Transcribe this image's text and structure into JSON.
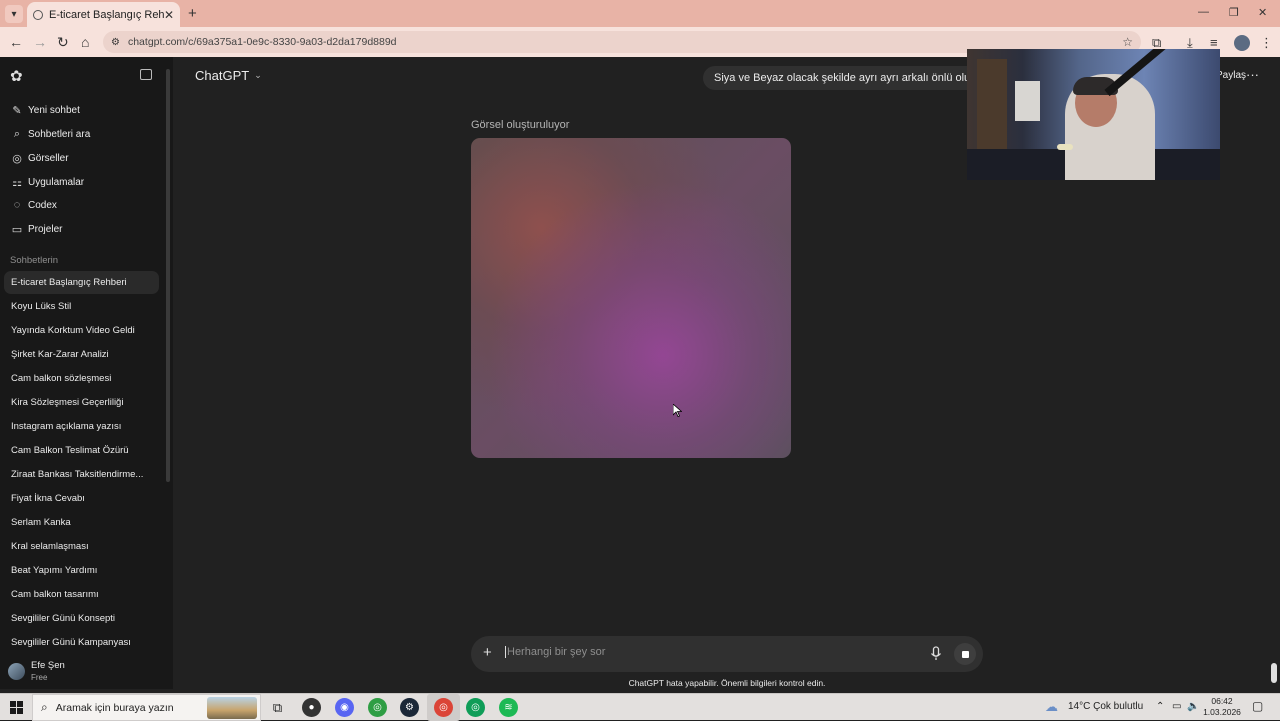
{
  "browser": {
    "tab_title": "E-ticaret Başlangıç Rehberi",
    "url": "chatgpt.com/c/69a375a1-0e9c-8330-9a03-d2da179d889d"
  },
  "sidebar": {
    "nav": [
      {
        "label": "Yeni sohbet",
        "icon": "edit-icon"
      },
      {
        "label": "Sohbetleri ara",
        "icon": "search-icon"
      },
      {
        "label": "Görseller",
        "icon": "images-icon"
      },
      {
        "label": "Uygulamalar",
        "icon": "apps-icon"
      },
      {
        "label": "Codex",
        "icon": "codex-icon"
      },
      {
        "label": "Projeler",
        "icon": "folder-icon"
      }
    ],
    "section_label": "Sohbetlerin",
    "chats": [
      "E-ticaret Başlangıç Rehberi",
      "Koyu Lüks Stil",
      "Yayında Korktum Video Geldi",
      "Şirket Kar-Zarar Analizi",
      "Cam balkon sözleşmesi",
      "Kira Sözleşmesi Geçerliliği",
      "Instagram açıklama yazısı",
      "Cam Balkon Teslimat Özürü",
      "Ziraat Bankası Taksitlendirme...",
      "Fiyat İkna Cevabı",
      "Serlam Kanka",
      "Kral selamlaşması",
      "Beat Yapımı Yardımı",
      "Cam balkon tasarımı",
      "Sevgililer Günü Konsepti",
      "Sevgililer Günü Kampanyası"
    ],
    "user": {
      "name": "Efe Şen",
      "plan": "Free"
    }
  },
  "main": {
    "model_label": "ChatGPT",
    "user_message": "Siya ve Beyaz olacak şekilde ayrı ayrı arkalı önlü oluştur",
    "share_label": "Paylaş",
    "generating_label": "Görsel oluşturuluyor",
    "composer_placeholder": "Herhangi bir şey sor",
    "disclaimer": "ChatGPT hata yapabilir. Önemli bilgileri kontrol edin."
  },
  "taskbar": {
    "search_placeholder": "Aramak için buraya yazın",
    "weather": "14°C  Çok bulutlu",
    "time": "06:42",
    "date": "1.03.2026"
  },
  "colors": {
    "sidebar_bg": "#181818",
    "main_bg": "#212121",
    "tabbar_bg": "#e8b3a6"
  }
}
